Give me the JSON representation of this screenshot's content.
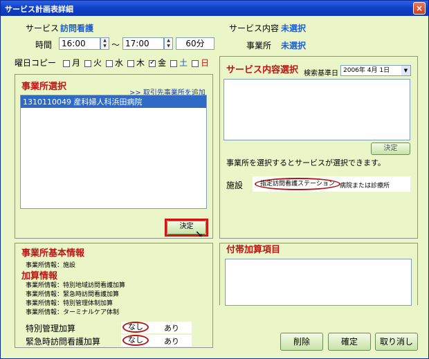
{
  "window": {
    "title": "サービス計画表詳細",
    "close_icon": "×"
  },
  "service": {
    "label": "サービス",
    "value": "訪問看護"
  },
  "time": {
    "label": "時間",
    "start": "16:00",
    "tilde": "〜",
    "end": "17:00",
    "duration": "60分"
  },
  "service_content": {
    "label": "サービス内容",
    "value": "未選択"
  },
  "office": {
    "label": "事業所",
    "value": "未選択"
  },
  "weekday_copy": {
    "label": "曜日コピー",
    "days": [
      {
        "label": "月",
        "checked": false,
        "color": "#000000"
      },
      {
        "label": "火",
        "checked": false,
        "color": "#000000"
      },
      {
        "label": "水",
        "checked": false,
        "color": "#000000"
      },
      {
        "label": "木",
        "checked": false,
        "color": "#000000"
      },
      {
        "label": "金",
        "checked": true,
        "color": "#000000"
      },
      {
        "label": "土",
        "checked": false,
        "color": "#1d5fd0"
      },
      {
        "label": "日",
        "checked": false,
        "color": "#d01010"
      }
    ]
  },
  "office_select": {
    "title": "事業所選択",
    "add_link": ">> 取引先事業所を追加",
    "items": [
      {
        "label": "1310110049 産科婦人科浜田病院",
        "selected": true
      }
    ],
    "decide_button": "決定"
  },
  "service_select": {
    "title": "サービス内容選択",
    "search_date_label": "検索基準日",
    "search_date_value": "2006年 4月 1日",
    "decide_button": "決定",
    "hint": "事業所を選択するとサービスが選択できます。",
    "facility_label": "施設",
    "facility_options": [
      "指定訪問看護ステーション",
      "病院または診療所"
    ]
  },
  "office_basic": {
    "title": "事業所基本情報",
    "info_line": "事業所情報：施設",
    "addition_title": "加算情報",
    "addition_lines": [
      "事業所情報：特別地域訪問看護加算",
      "事業所情報：緊急時訪問看護加算",
      "事業所情報：特別管理体制加算",
      "事業所情報：ターミナルケア体制"
    ],
    "choices": [
      {
        "label": "特別管理加算",
        "none": "なし",
        "yes": "あり"
      },
      {
        "label": "緊急時訪問看護加算",
        "none": "なし",
        "yes": "あり"
      }
    ]
  },
  "extra_items": {
    "title": "付帯加算項目"
  },
  "buttons": {
    "delete": "削除",
    "confirm": "確定",
    "cancel": "取り消し"
  }
}
